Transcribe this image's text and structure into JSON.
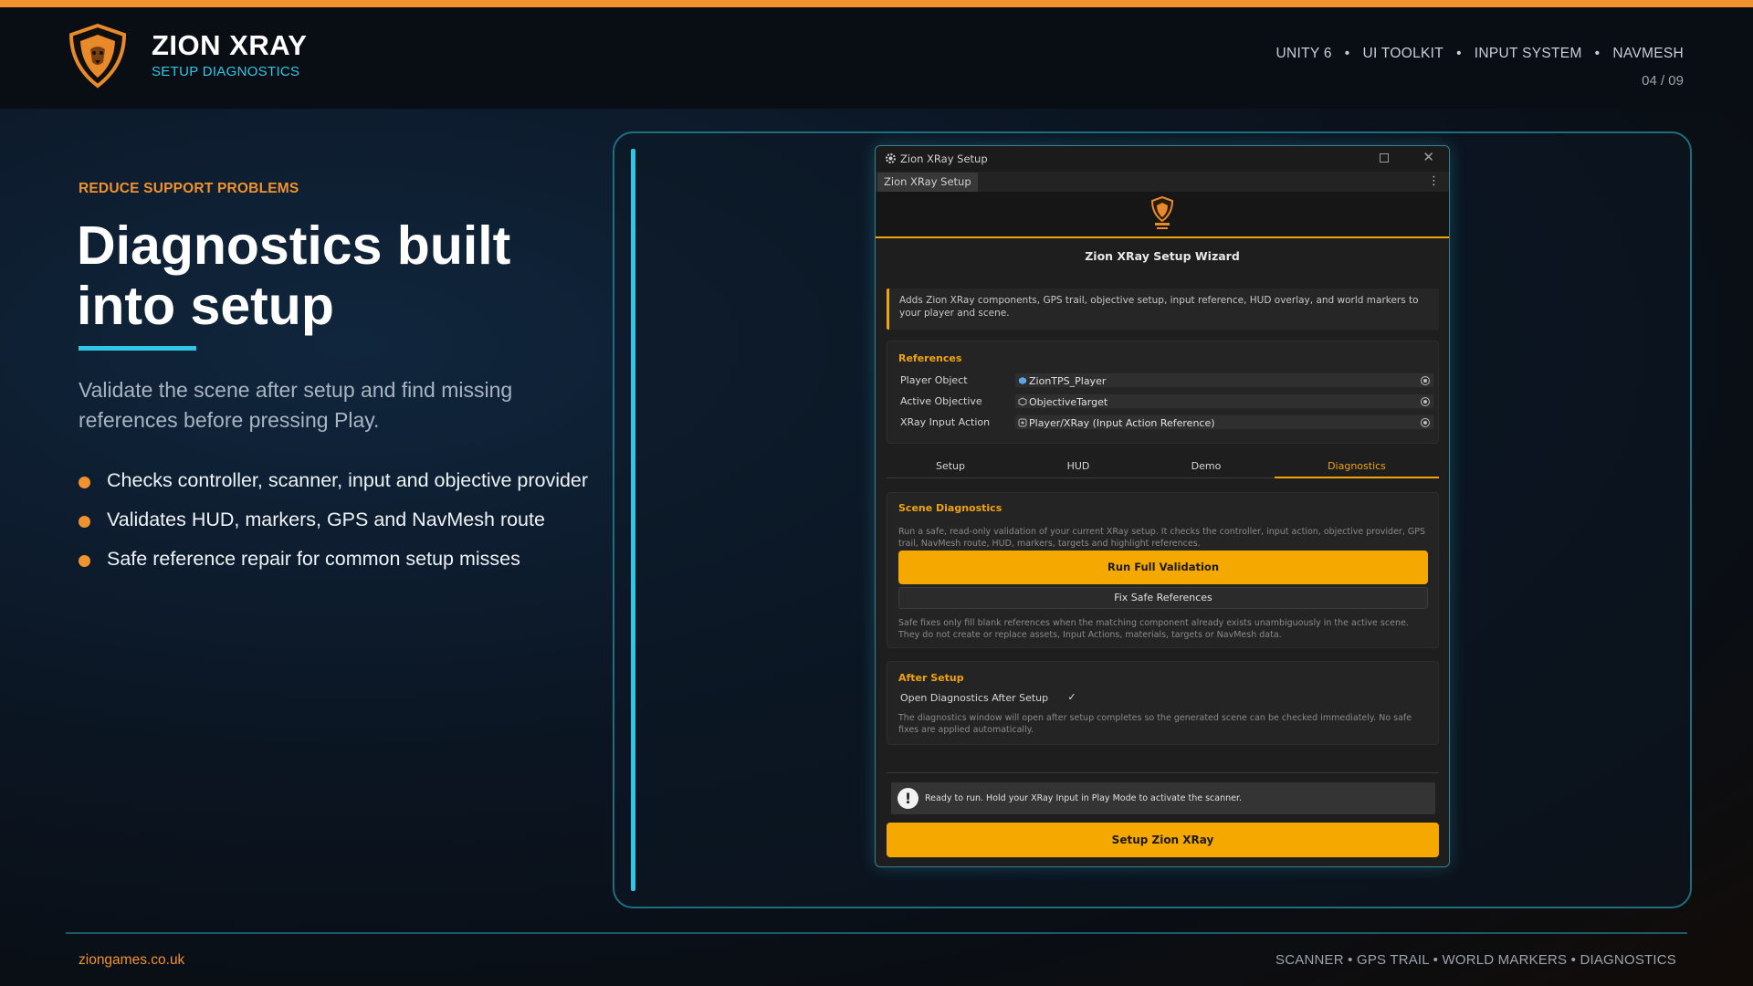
{
  "colors": {
    "accent_orange": "#f0922e",
    "accent_cyan": "#2ec8e6",
    "button_yellow": "#f5a800"
  },
  "header": {
    "title": "ZION XRAY",
    "subtitle": "SETUP DIAGNOSTICS",
    "tech": [
      "UNITY 6",
      "UI TOOLKIT",
      "INPUT SYSTEM",
      "NAVMESH"
    ],
    "separator": "•",
    "page": "04 / 09",
    "logo_icon": "lion-shield-logo"
  },
  "hero": {
    "eyebrow": "REDUCE SUPPORT PROBLEMS",
    "headline_line1": "Diagnostics built",
    "headline_line2": "into setup",
    "lede": "Validate the scene after setup and find missing references before pressing Play.",
    "bullets": [
      "Checks controller, scanner, input and objective provider",
      "Validates HUD, markers, GPS and NavMesh route",
      "Safe reference repair for common setup misses"
    ]
  },
  "window": {
    "title": "Zion XRay Setup",
    "tab": "Zion XRay Setup",
    "kebab": "⋮",
    "close": "✕",
    "wizard_title": "Zion XRay Setup Wizard",
    "info": "Adds Zion XRay components, GPS trail, objective setup, input reference, HUD overlay, and world markers to your player and scene.",
    "references": {
      "heading": "References",
      "rows": [
        {
          "label": "Player Object",
          "value": "ZionTPS_Player",
          "icon": "prefab-icon"
        },
        {
          "label": "Active Objective",
          "value": "ObjectiveTarget",
          "icon": "gameobject-icon"
        },
        {
          "label": "XRay Input Action",
          "value": "Player/XRay (Input Action Reference)",
          "icon": "input-action-icon"
        }
      ]
    },
    "tabs": [
      "Setup",
      "HUD",
      "Demo",
      "Diagnostics"
    ],
    "active_tab": "Diagnostics",
    "scene_diagnostics": {
      "heading": "Scene Diagnostics",
      "description": "Run a safe, read-only validation of your current XRay setup. It checks the controller, input action, objective provider, GPS trail, NavMesh route, HUD, markers, targets and highlight references.",
      "run_button": "Run Full Validation",
      "fix_button": "Fix Safe References",
      "note": "Safe fixes only fill blank references when the matching component already exists unambiguously in the active scene. They do not create or replace assets, Input Actions, materials, targets or NavMesh data."
    },
    "after_setup": {
      "heading": "After Setup",
      "toggle_label": "Open Diagnostics After Setup",
      "toggle_checked": true,
      "check_mark": "✓",
      "note": "The diagnostics window will open after setup completes so the generated scene can be checked immediately. No safe fixes are applied automatically."
    },
    "help": {
      "icon": "!",
      "text": "Ready to run. Hold your XRay Input in Play Mode to activate the scanner."
    },
    "setup_button": "Setup Zion XRay"
  },
  "footer": {
    "website": "ziongames.co.uk",
    "features": "SCANNER • GPS TRAIL • WORLD MARKERS • DIAGNOSTICS"
  }
}
